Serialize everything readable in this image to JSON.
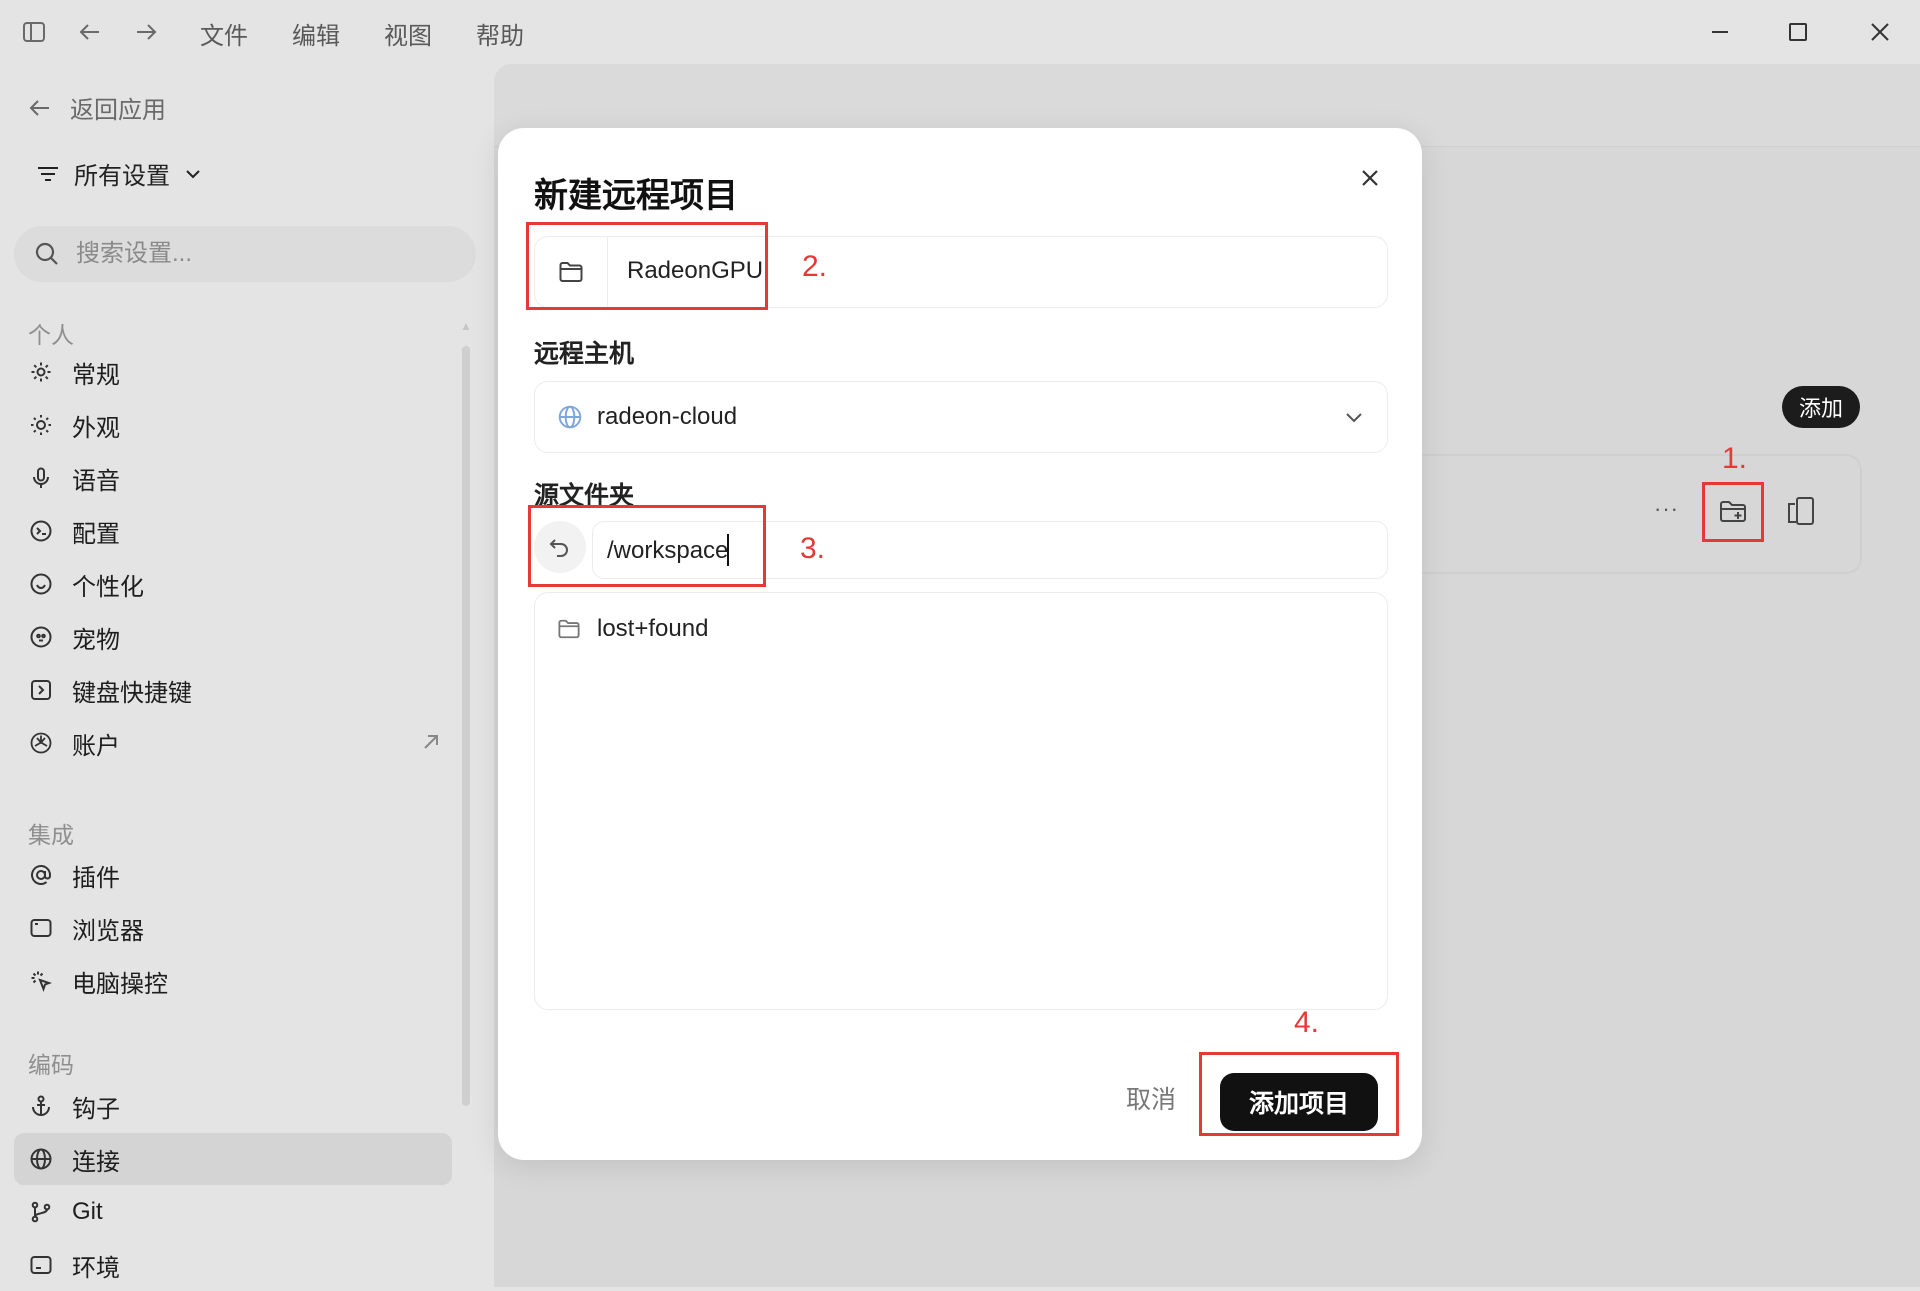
{
  "titlebar": {
    "menus": [
      "文件",
      "编辑",
      "视图",
      "帮助"
    ]
  },
  "sidebar": {
    "back_label": "返回应用",
    "all_settings_label": "所有设置",
    "search_placeholder": "搜索设置...",
    "sections": {
      "personal": "个人",
      "integrations": "集成",
      "coding": "编码"
    },
    "personal_items": [
      "常规",
      "外观",
      "语音",
      "配置",
      "个性化",
      "宠物",
      "键盘快捷键",
      "账户"
    ],
    "integration_items": [
      "插件",
      "浏览器",
      "电脑操控"
    ],
    "coding_items": [
      "钩子",
      "连接",
      "Git",
      "环境"
    ],
    "active_item": "连接"
  },
  "main": {
    "add_pill_label": "添加",
    "card_more": "···"
  },
  "dialog": {
    "title": "新建远程项目",
    "project_name": "RadeonGPU",
    "remote_host_label": "远程主机",
    "remote_host_value": "radeon-cloud",
    "source_folder_label": "源文件夹",
    "source_folder_value": "/workspace",
    "files": [
      "lost+found"
    ],
    "cancel_label": "取消",
    "add_label": "添加项目"
  },
  "annotations": {
    "n1": "1.",
    "n2": "2.",
    "n3": "3.",
    "n4": "4."
  },
  "colors": {
    "annotation_red": "#e53935",
    "primary_button": "#111111",
    "globe_accent": "#7fa6d9"
  }
}
